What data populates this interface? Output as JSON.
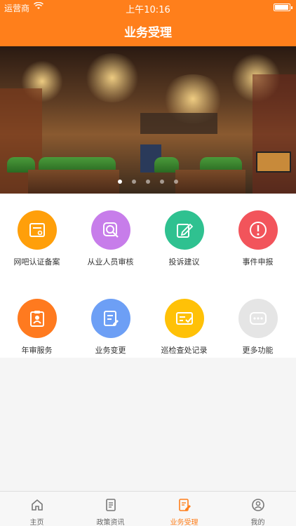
{
  "status_bar": {
    "carrier": "运营商",
    "time": "上午10:16"
  },
  "header": {
    "title": "业务受理"
  },
  "banner": {
    "slide_count": 5,
    "active_slide": 1
  },
  "services": [
    {
      "label": "网吧认证备案",
      "icon": "id-card-icon",
      "color": "#ff9f0a"
    },
    {
      "label": "从业人员审核",
      "icon": "magnifier-icon",
      "color": "#c77dea"
    },
    {
      "label": "投诉建议",
      "icon": "edit-icon",
      "color": "#2fc190"
    },
    {
      "label": "事件申报",
      "icon": "alert-icon",
      "color": "#f2545b"
    },
    {
      "label": "年审服务",
      "icon": "clipboard-person-icon",
      "color": "#ff7a1f"
    },
    {
      "label": "业务变更",
      "icon": "document-edit-icon",
      "color": "#6d9ff5"
    },
    {
      "label": "巡检查处记录",
      "icon": "checklist-icon",
      "color": "#ffc107"
    },
    {
      "label": "更多功能",
      "icon": "more-icon",
      "color": "#e5e5e5"
    }
  ],
  "tabs": [
    {
      "label": "主页",
      "icon": "home-icon"
    },
    {
      "label": "政策资讯",
      "icon": "news-icon"
    },
    {
      "label": "业务受理",
      "icon": "business-icon",
      "active": true
    },
    {
      "label": "我的",
      "icon": "user-icon"
    }
  ],
  "colors": {
    "accent": "#ff7f1b"
  }
}
